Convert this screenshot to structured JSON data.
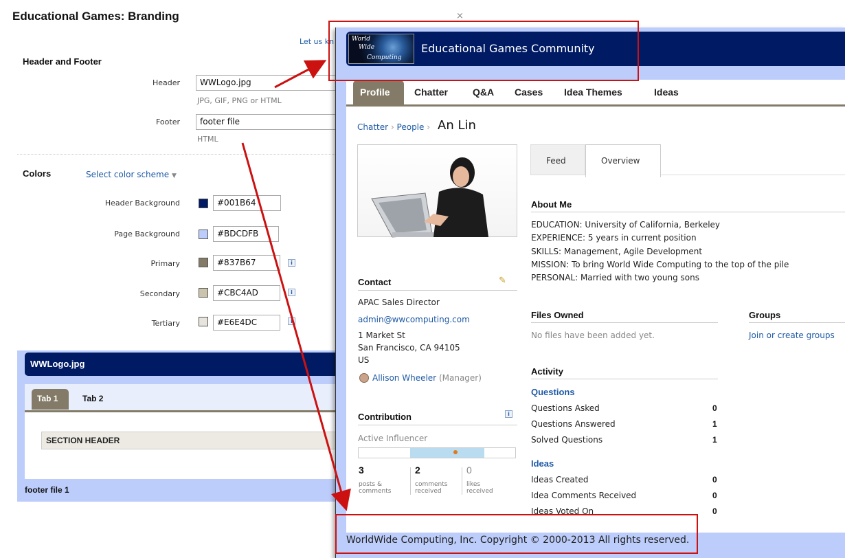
{
  "dialog": {
    "title": "Educational Games: Branding",
    "close": "×",
    "hint_link": "Let us know",
    "header_footer": {
      "title": "Header and Footer",
      "header_label": "Header",
      "header_value": "WWLogo.jpg",
      "header_hint": "JPG, GIF, PNG or HTML",
      "footer_label": "Footer",
      "footer_value": "footer file",
      "footer_hint": "HTML"
    },
    "colors": {
      "title": "Colors",
      "scheme_select": "Select color scheme",
      "items": [
        {
          "label": "Header Background",
          "value": "#001B64",
          "color": "#001B64"
        },
        {
          "label": "Page Background",
          "value": "#BDCDFB",
          "color": "#BDCDFB"
        },
        {
          "label": "Primary",
          "value": "#837B67",
          "color": "#837B67"
        },
        {
          "label": "Secondary",
          "value": "#CBC4AD",
          "color": "#CBC4AD"
        },
        {
          "label": "Tertiary",
          "value": "#E6E4DC",
          "color": "#E6E4DC"
        }
      ]
    },
    "preview": {
      "header": "WWLogo.jpg",
      "tab1": "Tab 1",
      "tab2": "Tab 2",
      "section": "SECTION HEADER",
      "footer": "footer file 1"
    }
  },
  "community": {
    "logo_lines": [
      "World",
      "Wide",
      "Computing"
    ],
    "title": "Educational Games Community",
    "nav": [
      "Profile",
      "Chatter",
      "Q&A",
      "Cases",
      "Idea Themes",
      "Ideas"
    ],
    "breadcrumb": [
      "Chatter",
      "People"
    ],
    "name": "An Lin",
    "tabs": [
      "Feed",
      "Overview"
    ],
    "about": {
      "title": "About Me",
      "lines": [
        "EDUCATION: University of California, Berkeley",
        "EXPERIENCE: 5 years in current position",
        "SKILLS: Management, Agile Development",
        "MISSION: To bring World Wide Computing to the top of the pile",
        "PERSONAL: Married with two young sons"
      ]
    },
    "contact": {
      "title": "Contact",
      "role": "APAC Sales Director",
      "email": "admin@wwcomputing.com",
      "addr1": "1 Market St",
      "addr2": "San Francisco, CA 94105",
      "country": "US",
      "manager": "Allison Wheeler",
      "manager_tag": "(Manager)"
    },
    "contribution": {
      "title": "Contribution",
      "level": "Active Influencer",
      "stats": [
        {
          "n": "3",
          "l1": "posts &",
          "l2": "comments"
        },
        {
          "n": "2",
          "l1": "comments",
          "l2": "received"
        },
        {
          "n": "0",
          "l1": "likes",
          "l2": "received"
        }
      ]
    },
    "files": {
      "title": "Files Owned",
      "empty": "No files have been added yet."
    },
    "groups": {
      "title": "Groups",
      "link": "Join or create groups"
    },
    "activity": {
      "title": "Activity",
      "questions": {
        "title": "Questions",
        "rows": [
          {
            "label": "Questions Asked",
            "value": "0"
          },
          {
            "label": "Questions Answered",
            "value": "1"
          },
          {
            "label": "Solved Questions",
            "value": "1"
          }
        ]
      },
      "ideas": {
        "title": "Ideas",
        "rows": [
          {
            "label": "Ideas Created",
            "value": "0"
          },
          {
            "label": "Idea Comments Received",
            "value": "0"
          },
          {
            "label": "Ideas Voted On",
            "value": "0"
          }
        ]
      }
    },
    "footer": "WorldWide Computing, Inc. Copyright © 2000-2013 All rights reserved."
  }
}
